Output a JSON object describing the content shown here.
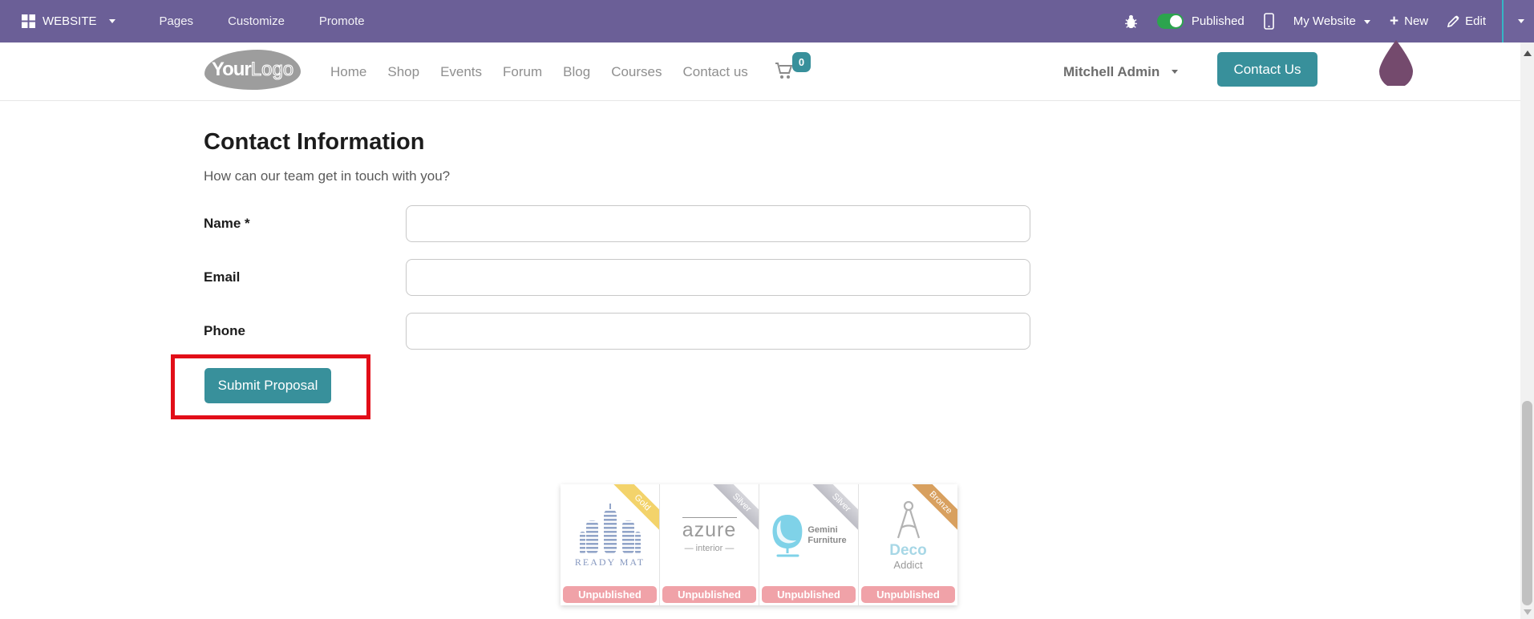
{
  "topbar": {
    "app_label": "WEBSITE",
    "menus": [
      "Pages",
      "Customize",
      "Promote"
    ],
    "published_label": "Published",
    "my_website_label": "My Website",
    "new_label": "New",
    "edit_label": "Edit"
  },
  "header": {
    "logo": {
      "your": "Your",
      "logo": "Logo"
    },
    "nav": [
      "Home",
      "Shop",
      "Events",
      "Forum",
      "Blog",
      "Courses",
      "Contact us"
    ],
    "cart_count": "0",
    "user_menu_label": "Mitchell Admin",
    "contact_button_label": "Contact Us"
  },
  "main": {
    "title": "Contact Information",
    "subtitle": "How can our team get in touch with you?",
    "fields": [
      {
        "label": "Name *",
        "value": ""
      },
      {
        "label": "Email",
        "value": ""
      },
      {
        "label": "Phone",
        "value": ""
      }
    ],
    "submit_label": "Submit Proposal"
  },
  "partners": {
    "cards": [
      {
        "ribbon": "Gold",
        "name": "READY MAT",
        "badge": "Unpublished"
      },
      {
        "ribbon": "Silver",
        "name": "azure",
        "tagline": "— interior —",
        "badge": "Unpublished"
      },
      {
        "ribbon": "Silver",
        "name": "Gemini",
        "name2": "Furniture",
        "badge": "Unpublished"
      },
      {
        "ribbon": "Bronze",
        "name": "Deco",
        "name2": "Addict",
        "badge": "Unpublished"
      }
    ]
  },
  "colors": {
    "topbar_purple": "#6b5f97",
    "accent_teal": "#38909b",
    "toggle_green": "#2ca44e",
    "highlight_red": "#e20e18",
    "unpublished_pink": "#f0a2a8",
    "ribbon_gold": "#f3d36b",
    "ribbon_silver": "#c9c9d0",
    "ribbon_bronze": "#d8a05f",
    "avatar_plum": "#744a6d"
  }
}
